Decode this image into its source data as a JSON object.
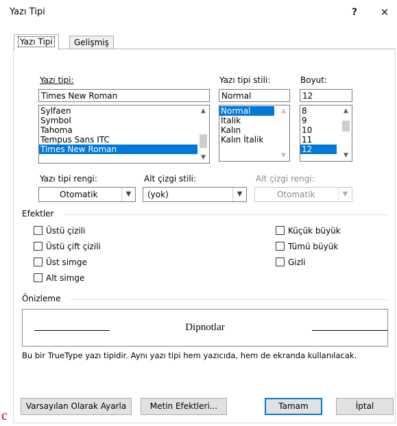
{
  "window": {
    "title": "Yazı Tipi",
    "help_label": "?",
    "close_label": "✕"
  },
  "tabs": [
    {
      "label": "Yazı Tipi"
    },
    {
      "label": "Gelişmiş"
    }
  ],
  "font": {
    "label": "Yazı tipi:",
    "value": "Times New Roman",
    "list": [
      "Sylfaen",
      "Symbol",
      "Tahoma",
      "Tempus Sans ITC",
      "Times New Roman"
    ]
  },
  "style": {
    "label": "Yazı tipi stili:",
    "value": "Normal",
    "list": [
      "Normal",
      "İtalik",
      "Kalın",
      "Kalın İtalik"
    ]
  },
  "size": {
    "label": "Boyut:",
    "value": "12",
    "list": [
      "8",
      "9",
      "10",
      "11",
      "12"
    ]
  },
  "font_color": {
    "label": "Yazı tipi rengi:",
    "value": "Otomatik"
  },
  "underline_style": {
    "label": "Alt çizgi stili:",
    "value": "(yok)"
  },
  "underline_color": {
    "label": "Alt çizgi rengi:",
    "value": "Otomatik"
  },
  "effects": {
    "label": "Efektler",
    "left": [
      "Üstü çizili",
      "Üstü çift çizili",
      "Üst simge",
      "Alt simge"
    ],
    "right": [
      "Küçük büyük",
      "Tümü büyük",
      "Gizli"
    ]
  },
  "preview": {
    "label": "Önizleme",
    "sample": "Dipnotlar",
    "note": "Bu bir TrueType yazı tipidir. Aynı yazı tipi hem yazıcıda, hem de ekranda kullanılacak."
  },
  "buttons": {
    "set_default": "Varsayılan Olarak Ayarla",
    "text_effects": "Metin Efektleri...",
    "ok": "Tamam",
    "cancel": "İptal"
  },
  "corner_text": "c",
  "colors": {
    "selection": "#0078d7",
    "corner_text": "#c00000"
  }
}
